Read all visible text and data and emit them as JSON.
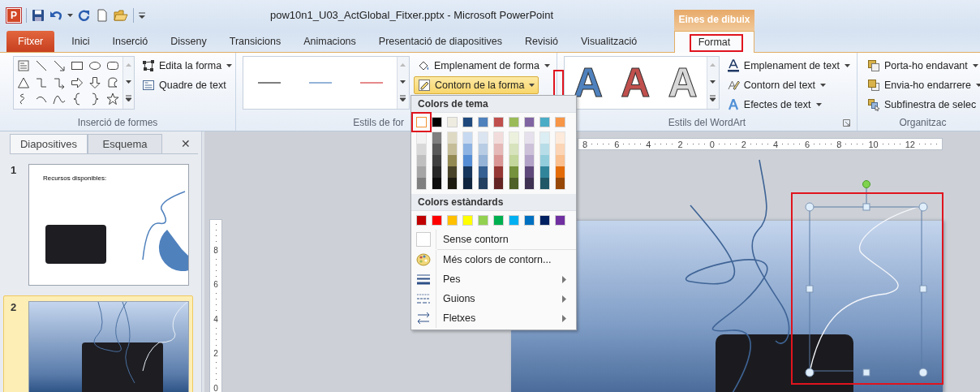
{
  "window": {
    "app_logo": "P",
    "title": "pow10n1_U03_ActGlobal_Fitxer.pptx - Microsoft PowerPoint",
    "contextual_group": "Eines de dibuix"
  },
  "tabs": [
    {
      "label": "Fitxer",
      "kind": "file",
      "selected": false,
      "highlighted": false
    },
    {
      "label": "Inici",
      "kind": "normal",
      "selected": false,
      "highlighted": false
    },
    {
      "label": "Inserció",
      "kind": "normal",
      "selected": false,
      "highlighted": false
    },
    {
      "label": "Disseny",
      "kind": "normal",
      "selected": false,
      "highlighted": false
    },
    {
      "label": "Transicions",
      "kind": "normal",
      "selected": false,
      "highlighted": false
    },
    {
      "label": "Animacions",
      "kind": "normal",
      "selected": false,
      "highlighted": false
    },
    {
      "label": "Presentació de diapositives",
      "kind": "normal",
      "selected": false,
      "highlighted": false
    },
    {
      "label": "Revisió",
      "kind": "normal",
      "selected": false,
      "highlighted": false
    },
    {
      "label": "Visualització",
      "kind": "normal",
      "selected": false,
      "highlighted": false
    },
    {
      "label": "Format",
      "kind": "contextual",
      "selected": true,
      "highlighted": true
    }
  ],
  "ribbon": {
    "groups": [
      {
        "kind": "shapes",
        "label": "Inserció de formes",
        "buttons": [
          {
            "label": "Edita la forma",
            "dropdown": true,
            "active": false,
            "highlighted": false
          },
          {
            "label": "Quadre de text",
            "dropdown": false,
            "active": false,
            "highlighted": false
          }
        ]
      },
      {
        "kind": "shape_styles",
        "label": "Estils de for",
        "previews": [
          {
            "color": "#7f7f7f"
          },
          {
            "color": "#95b3d7"
          },
          {
            "color": "#e6898a"
          }
        ],
        "buttons": [
          {
            "label": "Emplenament de forma",
            "dropdown": true,
            "active": false,
            "highlighted": false
          },
          {
            "label": "Contorn de la forma",
            "dropdown": true,
            "active": true,
            "highlighted": true
          }
        ]
      },
      {
        "kind": "wordart",
        "label": "Estils del WordArt",
        "styles": [
          {
            "text": "A",
            "color": "#4f81bd"
          },
          {
            "text": "A",
            "color": "#c0504d"
          },
          {
            "text": "A",
            "color": "#d8d8d8"
          }
        ],
        "buttons": [
          {
            "label": "Emplenament de text",
            "dropdown": true,
            "active": false,
            "highlighted": false
          },
          {
            "label": "Contorn del text",
            "dropdown": true,
            "active": false,
            "highlighted": false
          },
          {
            "label": "Efectes de text",
            "dropdown": true,
            "active": false,
            "highlighted": false
          }
        ]
      },
      {
        "kind": "arrange",
        "label": "Organitzac",
        "buttons": [
          {
            "label": "Porta-ho endavant",
            "dropdown": true,
            "active": false,
            "highlighted": false
          },
          {
            "label": "Envia-ho endarrere",
            "dropdown": true,
            "active": false,
            "highlighted": false
          },
          {
            "label": "Subfinestra de selec",
            "dropdown": false,
            "active": false,
            "highlighted": false
          }
        ]
      }
    ]
  },
  "outline_menu": {
    "theme_header": "Colors de tema",
    "theme_colors": [
      {
        "color": "#ffffff",
        "selected": true,
        "highlighted": true,
        "shades": [
          {
            "color": "#f2f2f2"
          },
          {
            "color": "#d8d8d8"
          },
          {
            "color": "#bfbfbf"
          },
          {
            "color": "#a5a5a5"
          },
          {
            "color": "#7f7f7f"
          }
        ]
      },
      {
        "color": "#000000",
        "selected": false,
        "highlighted": false,
        "shades": [
          {
            "color": "#7f7f7f"
          },
          {
            "color": "#595959"
          },
          {
            "color": "#3f3f3f"
          },
          {
            "color": "#262626"
          },
          {
            "color": "#0c0c0c"
          }
        ]
      },
      {
        "color": "#eeece1",
        "selected": false,
        "highlighted": false,
        "shades": [
          {
            "color": "#ddd9c3"
          },
          {
            "color": "#c4bd97"
          },
          {
            "color": "#938953"
          },
          {
            "color": "#494429"
          },
          {
            "color": "#1d1b10"
          }
        ]
      },
      {
        "color": "#1f497d",
        "selected": false,
        "highlighted": false,
        "shades": [
          {
            "color": "#c6d9f0"
          },
          {
            "color": "#8db3e2"
          },
          {
            "color": "#548dd4"
          },
          {
            "color": "#17365d"
          },
          {
            "color": "#0f243e"
          }
        ]
      },
      {
        "color": "#4f81bd",
        "selected": false,
        "highlighted": false,
        "shades": [
          {
            "color": "#dbe5f1"
          },
          {
            "color": "#b8cce4"
          },
          {
            "color": "#95b3d7"
          },
          {
            "color": "#366092"
          },
          {
            "color": "#244061"
          }
        ]
      },
      {
        "color": "#c0504d",
        "selected": false,
        "highlighted": false,
        "shades": [
          {
            "color": "#f2dcdb"
          },
          {
            "color": "#e5b9b7"
          },
          {
            "color": "#d99694"
          },
          {
            "color": "#953734"
          },
          {
            "color": "#632423"
          }
        ]
      },
      {
        "color": "#9bbb59",
        "selected": false,
        "highlighted": false,
        "shades": [
          {
            "color": "#ebf1dd"
          },
          {
            "color": "#d7e3bc"
          },
          {
            "color": "#c3d69b"
          },
          {
            "color": "#76923c"
          },
          {
            "color": "#4f6128"
          }
        ]
      },
      {
        "color": "#8064a2",
        "selected": false,
        "highlighted": false,
        "shades": [
          {
            "color": "#e5e0ec"
          },
          {
            "color": "#ccc1d9"
          },
          {
            "color": "#b2a2c7"
          },
          {
            "color": "#5f497a"
          },
          {
            "color": "#3f3151"
          }
        ]
      },
      {
        "color": "#4bacc6",
        "selected": false,
        "highlighted": false,
        "shades": [
          {
            "color": "#dbeef3"
          },
          {
            "color": "#b7dde8"
          },
          {
            "color": "#92cddc"
          },
          {
            "color": "#31859b"
          },
          {
            "color": "#205867"
          }
        ]
      },
      {
        "color": "#f79646",
        "selected": false,
        "highlighted": false,
        "shades": [
          {
            "color": "#fdeada"
          },
          {
            "color": "#fbd5b5"
          },
          {
            "color": "#fac08f"
          },
          {
            "color": "#e36c09"
          },
          {
            "color": "#974806"
          }
        ]
      }
    ],
    "standard_header": "Colors estàndards",
    "standard_colors": [
      {
        "color": "#c00000"
      },
      {
        "color": "#ff0000"
      },
      {
        "color": "#ffc000"
      },
      {
        "color": "#ffff00"
      },
      {
        "color": "#92d050"
      },
      {
        "color": "#00b050"
      },
      {
        "color": "#00b0f0"
      },
      {
        "color": "#0070c0"
      },
      {
        "color": "#002060"
      },
      {
        "color": "#7030a0"
      }
    ],
    "items": [
      {
        "kind": "no_outline",
        "label": "Sense contorn",
        "submenu": false
      },
      {
        "kind": "more_colors",
        "label": "Més colors de contorn...",
        "submenu": false
      },
      {
        "kind": "weight",
        "label": "Pes",
        "submenu": true
      },
      {
        "kind": "dashes",
        "label": "Guions",
        "submenu": true
      },
      {
        "kind": "arrows",
        "label": "Fletxes",
        "submenu": true
      }
    ]
  },
  "slides_panel": {
    "tabs": [
      {
        "label": "Diapositives",
        "selected": true
      },
      {
        "label": "Esquema",
        "selected": false
      }
    ],
    "close": "✕",
    "slides": [
      {
        "number": "1",
        "kind": "white",
        "selected": false,
        "text": "Recursos disponibles:"
      },
      {
        "number": "2",
        "kind": "gradient",
        "selected": true
      }
    ]
  },
  "rulers": {
    "horizontal": [
      "8",
      "6",
      "4",
      "2",
      "0",
      "2",
      "4",
      "6",
      "8",
      "10",
      "12"
    ],
    "vertical": [
      "8",
      "6",
      "4",
      "2",
      "0"
    ]
  },
  "canvas": {
    "selection_highlighted": true
  }
}
